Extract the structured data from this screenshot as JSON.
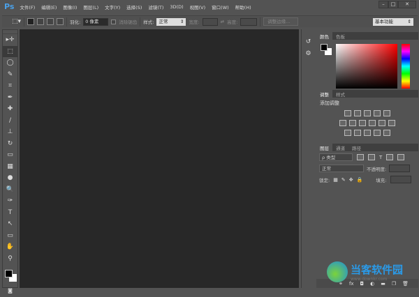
{
  "app": {
    "logo": "Ps"
  },
  "menu": [
    "文件(F)",
    "编辑(E)",
    "图像(I)",
    "图层(L)",
    "文字(Y)",
    "选择(S)",
    "滤镜(T)",
    "3D(D)",
    "视图(V)",
    "窗口(W)",
    "帮助(H)"
  ],
  "window": {
    "minimize": "–",
    "maximize": "□",
    "close": "✕"
  },
  "options": {
    "feather_label": "羽化:",
    "feather_value": "0 像素",
    "antialias": "消除锯齿",
    "style_label": "样式:",
    "style_value": "正常",
    "width_label": "宽度:",
    "height_label": "高度:",
    "refine_edge": "调整边缘...",
    "workspace": "基本功能"
  },
  "tools": [
    "▸✛",
    "⬚",
    "◯",
    "✎",
    "⌗",
    "✒",
    "✚",
    "/",
    "⊥",
    "↻",
    "▭",
    "▦",
    "●",
    "🔍",
    "✑",
    "T",
    "↖",
    "▭",
    "✋",
    "⚲"
  ],
  "color_panel": {
    "tabs": [
      "颜色",
      "色板"
    ]
  },
  "adjust_panel": {
    "tabs": [
      "调整",
      "样式"
    ],
    "title": "添加调整"
  },
  "layers_panel": {
    "tabs": [
      "图层",
      "通道",
      "路径"
    ],
    "filter": "ρ 类型",
    "blend": "正常",
    "opacity_label": "不透明度:",
    "lock_label": "锁定:",
    "fill_label": "填充:"
  },
  "watermark": {
    "name": "当客软件园",
    "url": "www.downkr.com"
  }
}
